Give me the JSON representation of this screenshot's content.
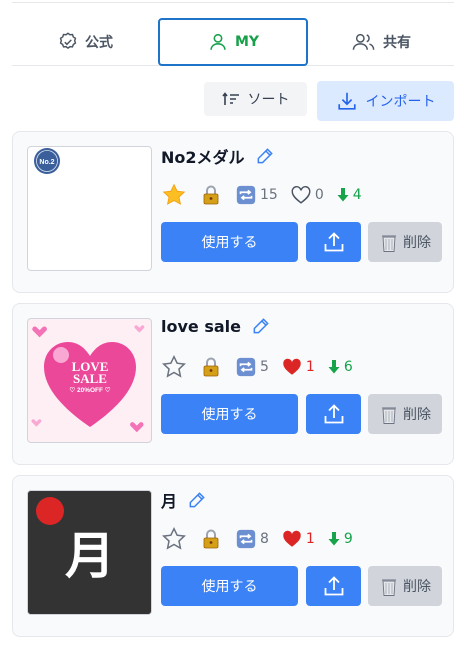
{
  "tabs": [
    {
      "label": "公式",
      "icon": "check-circle-icon"
    },
    {
      "label": "MY",
      "icon": "user-icon"
    },
    {
      "label": "共有",
      "icon": "users-icon"
    }
  ],
  "toolbar": {
    "sort_label": "ソート",
    "import_label": "インポート"
  },
  "colors": {
    "active_tab_border": "#1d74c9",
    "active_tab_text": "#18a04a",
    "primary": "#3b82f6",
    "like": "#dc2626",
    "download": "#16a34a"
  },
  "cards": [
    {
      "title": "No2メダル",
      "thumb_text": "No.2",
      "starred": true,
      "locked": true,
      "repeat_count": "15",
      "like_count": "0",
      "liked": false,
      "download_count": "4",
      "use_label": "使用する",
      "delete_label": "削除"
    },
    {
      "title": "love sale",
      "thumb_text_1": "LOVE",
      "thumb_text_2": "SALE",
      "thumb_text_3": "♡ 20%OFF ♡",
      "starred": false,
      "locked": true,
      "repeat_count": "5",
      "like_count": "1",
      "liked": true,
      "download_count": "6",
      "use_label": "使用する",
      "delete_label": "削除"
    },
    {
      "title": "月",
      "thumb_text": "月",
      "starred": false,
      "locked": true,
      "repeat_count": "8",
      "like_count": "1",
      "liked": true,
      "download_count": "9",
      "use_label": "使用する",
      "delete_label": "削除"
    }
  ]
}
